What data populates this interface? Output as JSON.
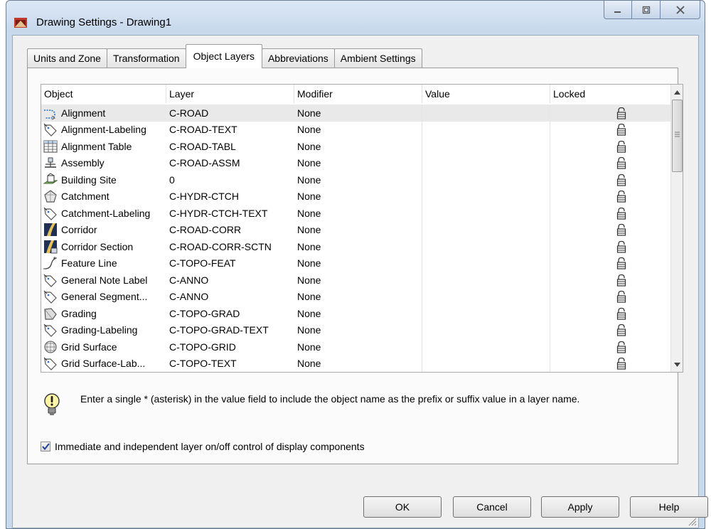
{
  "window": {
    "title": "Drawing Settings - Drawing1",
    "controls": [
      "minimize",
      "maximize",
      "close"
    ]
  },
  "tabs": [
    {
      "label": "Units and Zone",
      "active": false
    },
    {
      "label": "Transformation",
      "active": false
    },
    {
      "label": "Object Layers",
      "active": true
    },
    {
      "label": "Abbreviations",
      "active": false
    },
    {
      "label": "Ambient Settings",
      "active": false
    }
  ],
  "grid": {
    "columns": [
      "Object",
      "Layer",
      "Modifier",
      "Value",
      "Locked"
    ],
    "rows": [
      {
        "icon": "alignment-icon",
        "object": "Alignment",
        "layer": "C-ROAD",
        "modifier": "None",
        "value": "",
        "locked": "unlocked-icon"
      },
      {
        "icon": "label-tag-icon",
        "object": "Alignment-Labeling",
        "layer": "C-ROAD-TEXT",
        "modifier": "None",
        "value": "",
        "locked": "unlocked-icon"
      },
      {
        "icon": "table-icon",
        "object": "Alignment Table",
        "layer": "C-ROAD-TABL",
        "modifier": "None",
        "value": "",
        "locked": "unlocked-icon"
      },
      {
        "icon": "assembly-icon",
        "object": "Assembly",
        "layer": "C-ROAD-ASSM",
        "modifier": "None",
        "value": "",
        "locked": "unlocked-icon"
      },
      {
        "icon": "building-site-icon",
        "object": "Building Site",
        "layer": "0",
        "modifier": "None",
        "value": "",
        "locked": "unlocked-icon"
      },
      {
        "icon": "catchment-icon",
        "object": "Catchment",
        "layer": "C-HYDR-CTCH",
        "modifier": "None",
        "value": "",
        "locked": "unlocked-icon"
      },
      {
        "icon": "label-tag-icon",
        "object": "Catchment-Labeling",
        "layer": "C-HYDR-CTCH-TEXT",
        "modifier": "None",
        "value": "",
        "locked": "unlocked-icon"
      },
      {
        "icon": "corridor-icon",
        "object": "Corridor",
        "layer": "C-ROAD-CORR",
        "modifier": "None",
        "value": "",
        "locked": "unlocked-icon"
      },
      {
        "icon": "corridor-section-icon",
        "object": "Corridor Section",
        "layer": "C-ROAD-CORR-SCTN",
        "modifier": "None",
        "value": "",
        "locked": "unlocked-icon"
      },
      {
        "icon": "feature-line-icon",
        "object": "Feature Line",
        "layer": "C-TOPO-FEAT",
        "modifier": "None",
        "value": "",
        "locked": "unlocked-icon"
      },
      {
        "icon": "label-tag-icon",
        "object": "General Note Label",
        "layer": "C-ANNO",
        "modifier": "None",
        "value": "",
        "locked": "unlocked-icon"
      },
      {
        "icon": "label-tag-icon",
        "object": "General Segment...",
        "layer": "C-ANNO",
        "modifier": "None",
        "value": "",
        "locked": "unlocked-icon"
      },
      {
        "icon": "grading-icon",
        "object": "Grading",
        "layer": "C-TOPO-GRAD",
        "modifier": "None",
        "value": "",
        "locked": "unlocked-icon"
      },
      {
        "icon": "label-tag-icon",
        "object": "Grading-Labeling",
        "layer": "C-TOPO-GRAD-TEXT",
        "modifier": "None",
        "value": "",
        "locked": "unlocked-icon"
      },
      {
        "icon": "grid-surface-icon",
        "object": "Grid Surface",
        "layer": "C-TOPO-GRID",
        "modifier": "None",
        "value": "",
        "locked": "unlocked-icon"
      },
      {
        "icon": "label-tag-icon",
        "object": "Grid Surface-Lab...",
        "layer": "C-TOPO-TEXT",
        "modifier": "None",
        "value": "",
        "locked": "unlocked-icon"
      }
    ]
  },
  "note": {
    "icon": "lightbulb-icon",
    "text": "Enter a single * (asterisk) in the value field to include the object name as the prefix or suffix value in a layer name."
  },
  "checkbox": {
    "label": "Immediate and independent layer on/off control of display components",
    "checked": true
  },
  "buttons": {
    "ok": "OK",
    "cancel": "Cancel",
    "apply": "Apply",
    "help": "Help"
  }
}
